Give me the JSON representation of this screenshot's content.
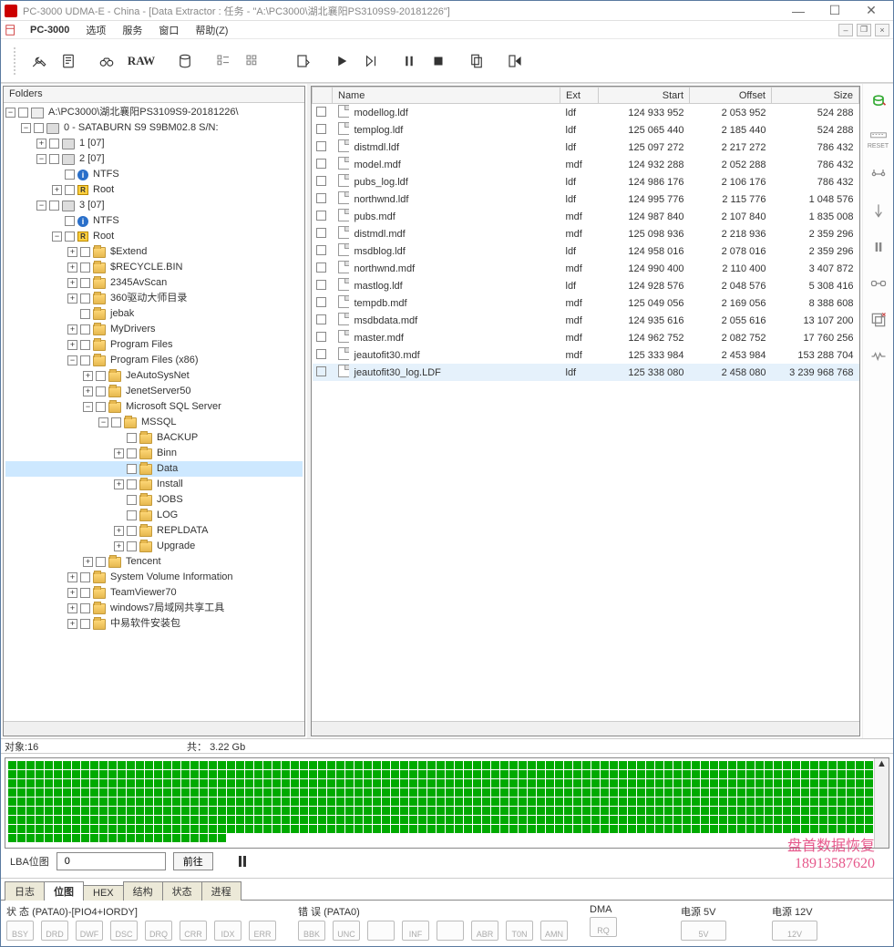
{
  "window": {
    "title": "PC-3000 UDMA-E - China - [Data Extractor : 任务 - \"A:\\PC3000\\湖北襄阳PS3109S9-20181226\"]"
  },
  "menu": {
    "app": "PC-3000",
    "items": [
      "选项",
      "服务",
      "窗口",
      "帮助(Z)"
    ]
  },
  "toolbar_raw": "RAW",
  "folders": {
    "header": "Folders",
    "root": "A:\\PC3000\\湖北襄阳PS3109S9-20181226\\",
    "device": "0 - SATABURN   S9 S9BM02.8  S/N:",
    "p1": "1 [07]",
    "p2": "2 [07]",
    "p3": "3 [07]",
    "ntfs": "NTFS",
    "root_label": "Root",
    "items": {
      "extend": "$Extend",
      "recycle": "$RECYCLE.BIN",
      "avscan": "2345AvScan",
      "driver360": "360驱动大师目录",
      "jebak": "jebak",
      "mydrivers": "MyDrivers",
      "pf": "Program Files",
      "pfx86": "Program Files (x86)",
      "jeauto": "JeAutoSysNet",
      "jenet": "JenetServer50",
      "mssql_server": "Microsoft SQL Server",
      "mssql": "MSSQL",
      "backup": "BACKUP",
      "binn": "Binn",
      "data": "Data",
      "install": "Install",
      "jobs": "JOBS",
      "log": "LOG",
      "repldata": "REPLDATA",
      "upgrade": "Upgrade",
      "tencent": "Tencent",
      "svi": "System Volume Information",
      "teamviewer": "TeamViewer70",
      "win7share": "windows7局域网共享工具",
      "zhongyi": "中易软件安装包"
    }
  },
  "files": {
    "columns": {
      "name": "Name",
      "ext": "Ext",
      "start": "Start",
      "offset": "Offset",
      "size": "Size"
    },
    "rows": [
      {
        "name": "modellog.ldf",
        "ext": "ldf",
        "start": "124 933 952",
        "offset": "2 053 952",
        "size": "524 288"
      },
      {
        "name": "templog.ldf",
        "ext": "ldf",
        "start": "125 065 440",
        "offset": "2 185 440",
        "size": "524 288"
      },
      {
        "name": "distmdl.ldf",
        "ext": "ldf",
        "start": "125 097 272",
        "offset": "2 217 272",
        "size": "786 432"
      },
      {
        "name": "model.mdf",
        "ext": "mdf",
        "start": "124 932 288",
        "offset": "2 052 288",
        "size": "786 432"
      },
      {
        "name": "pubs_log.ldf",
        "ext": "ldf",
        "start": "124 986 176",
        "offset": "2 106 176",
        "size": "786 432"
      },
      {
        "name": "northwnd.ldf",
        "ext": "ldf",
        "start": "124 995 776",
        "offset": "2 115 776",
        "size": "1 048 576"
      },
      {
        "name": "pubs.mdf",
        "ext": "mdf",
        "start": "124 987 840",
        "offset": "2 107 840",
        "size": "1 835 008"
      },
      {
        "name": "distmdl.mdf",
        "ext": "mdf",
        "start": "125 098 936",
        "offset": "2 218 936",
        "size": "2 359 296"
      },
      {
        "name": "msdblog.ldf",
        "ext": "ldf",
        "start": "124 958 016",
        "offset": "2 078 016",
        "size": "2 359 296"
      },
      {
        "name": "northwnd.mdf",
        "ext": "mdf",
        "start": "124 990 400",
        "offset": "2 110 400",
        "size": "3 407 872"
      },
      {
        "name": "mastlog.ldf",
        "ext": "ldf",
        "start": "124 928 576",
        "offset": "2 048 576",
        "size": "5 308 416"
      },
      {
        "name": "tempdb.mdf",
        "ext": "mdf",
        "start": "125 049 056",
        "offset": "2 169 056",
        "size": "8 388 608"
      },
      {
        "name": "msdbdata.mdf",
        "ext": "mdf",
        "start": "124 935 616",
        "offset": "2 055 616",
        "size": "13 107 200"
      },
      {
        "name": "master.mdf",
        "ext": "mdf",
        "start": "124 962 752",
        "offset": "2 082 752",
        "size": "17 760 256"
      },
      {
        "name": "jeautofit30.mdf",
        "ext": "mdf",
        "start": "125 333 984",
        "offset": "2 453 984",
        "size": "153 288 704"
      },
      {
        "name": "jeautofit30_log.LDF",
        "ext": "ldf",
        "start": "125 338 080",
        "offset": "2 458 080",
        "size": "3 239 968 768"
      }
    ]
  },
  "status": {
    "objects_label": "对象:",
    "objects_value": "16",
    "total_label": "共：",
    "total_value": "3.22 Gb"
  },
  "lba": {
    "label": "LBA位图",
    "value": "0",
    "go": "前往"
  },
  "tabs": [
    "日志",
    "位图",
    "HEX",
    "结构",
    "状态",
    "进程"
  ],
  "active_tab": 1,
  "hw": {
    "state_label": "状 态 (PATA0)-[PIO4+IORDY]",
    "state_slots": [
      "BSY",
      "DRD",
      "DWF",
      "DSC",
      "DRQ",
      "CRR",
      "IDX",
      "ERR"
    ],
    "err_label": "错 误 (PATA0)",
    "err_slots": [
      "BBK",
      "UNC",
      "",
      "INF",
      "",
      "ABR",
      "T0N",
      "AMN"
    ],
    "dma_label": "DMA",
    "dma_slots": [
      "RQ"
    ],
    "pwr5_label": "电源 5V",
    "pwr5_slot": "5V",
    "pwr12_label": "电源 12V",
    "pwr12_slot": "12V"
  },
  "watermark": {
    "line1": "盘首数据恢复",
    "line2": "18913587620"
  },
  "bubble": "45",
  "right_reset": "RESET"
}
